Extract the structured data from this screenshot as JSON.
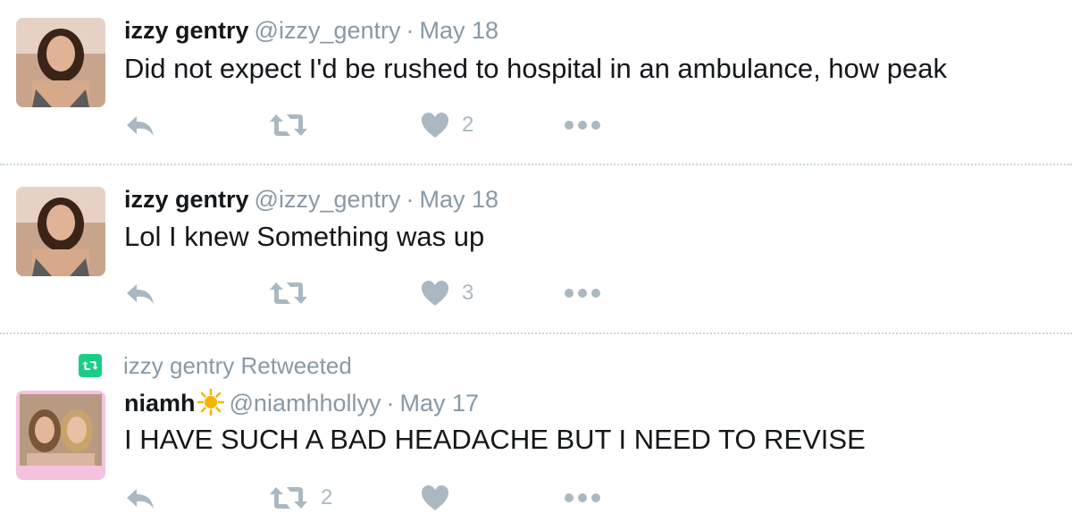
{
  "colors": {
    "text": "#14171a",
    "muted": "#8899a6",
    "icon": "#aab8c2",
    "retweet_green": "#19cf86",
    "divider": "#c7d8dc"
  },
  "tweets": [
    {
      "display_name": "izzy gentry",
      "handle": "@izzy_gentry",
      "separator": "·",
      "date": "May 18",
      "text": "Did not expect I'd be rushed to hospital in an ambulance, how peak",
      "avatar_icon": "profile-photo",
      "counts": {
        "reply": "",
        "retweet": "",
        "like": "2"
      }
    },
    {
      "display_name": "izzy gentry",
      "handle": "@izzy_gentry",
      "separator": "·",
      "date": "May 18",
      "text": "Lol I knew Something was up",
      "avatar_icon": "profile-photo",
      "counts": {
        "reply": "",
        "retweet": "",
        "like": "3"
      }
    },
    {
      "retweet_context": "izzy gentry Retweeted",
      "display_name": "niamh",
      "name_emoji": "sun-emoji",
      "handle": "@niamhhollyy",
      "separator": "·",
      "date": "May 17",
      "text": "I HAVE SUCH A BAD HEADACHE BUT I NEED TO REVISE",
      "avatar_icon": "profile-photo-two-people",
      "counts": {
        "reply": "",
        "retweet": "2",
        "like": ""
      }
    }
  ]
}
